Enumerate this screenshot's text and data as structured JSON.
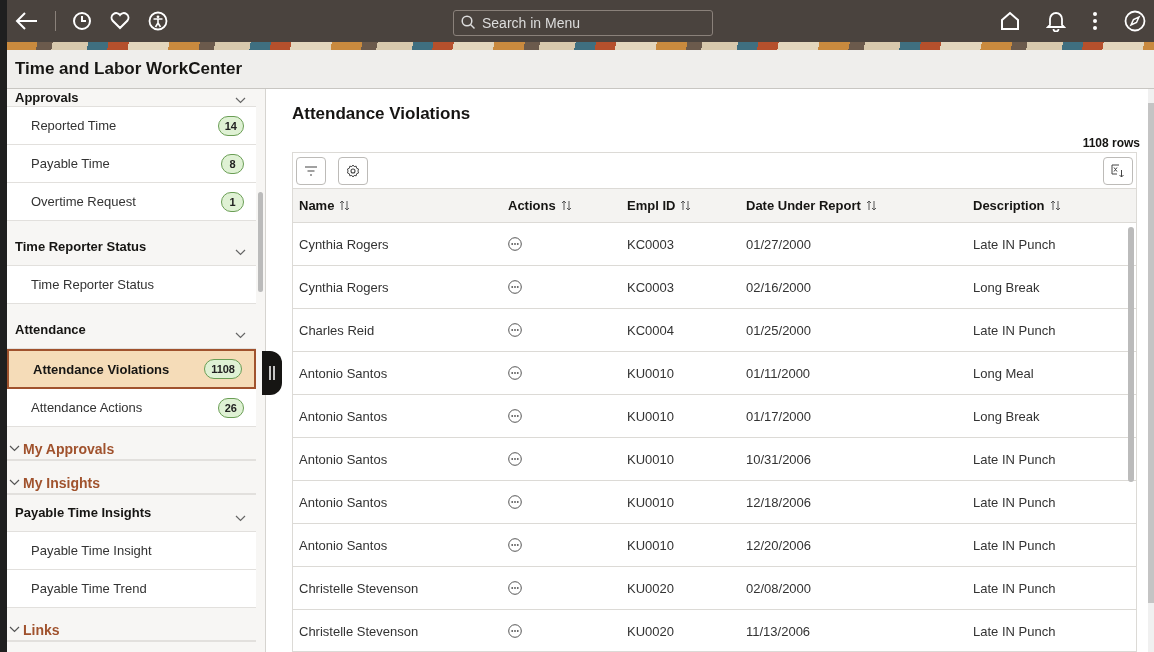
{
  "header": {
    "search": {
      "placeholder": "Search in Menu"
    }
  },
  "page_title": "Time and Labor WorkCenter",
  "sidebar": {
    "items": [
      {
        "kind": "group",
        "label": "Approvals"
      },
      {
        "kind": "link",
        "label": "Reported Time",
        "badge": "14",
        "selected": false
      },
      {
        "kind": "link",
        "label": "Payable Time",
        "badge": "8",
        "selected": false
      },
      {
        "kind": "link",
        "label": "Overtime Request",
        "badge": "1",
        "selected": false
      },
      {
        "kind": "group",
        "label": "Time Reporter Status"
      },
      {
        "kind": "link",
        "label": "Time Reporter Status",
        "selected": false
      },
      {
        "kind": "group",
        "label": "Attendance"
      },
      {
        "kind": "link",
        "label": "Attendance Violations",
        "badge": "1108",
        "selected": true
      },
      {
        "kind": "link",
        "label": "Attendance Actions",
        "badge": "26",
        "selected": false
      },
      {
        "kind": "category",
        "label": "My Approvals"
      },
      {
        "kind": "category",
        "label": "My Insights"
      },
      {
        "kind": "group",
        "label": "Payable Time Insights"
      },
      {
        "kind": "link",
        "label": "Payable Time Insight",
        "selected": false
      },
      {
        "kind": "link",
        "label": "Payable Time Trend",
        "selected": false
      },
      {
        "kind": "category",
        "label": "Links"
      }
    ]
  },
  "content": {
    "title": "Attendance Violations",
    "row_count": "1108 rows",
    "table": {
      "columns": [
        "Name",
        "Actions",
        "Empl ID",
        "Date Under Report",
        "Description"
      ],
      "rows": [
        [
          "Cynthia Rogers",
          "",
          "KC0003",
          "01/27/2000",
          "Late IN Punch"
        ],
        [
          "Cynthia Rogers",
          "",
          "KC0003",
          "02/16/2000",
          "Long Break"
        ],
        [
          "Charles Reid",
          "",
          "KC0004",
          "01/25/2000",
          "Late IN Punch"
        ],
        [
          "Antonio Santos",
          "",
          "KU0010",
          "01/11/2000",
          "Long Meal"
        ],
        [
          "Antonio Santos",
          "",
          "KU0010",
          "01/17/2000",
          "Long Break"
        ],
        [
          "Antonio Santos",
          "",
          "KU0010",
          "10/31/2006",
          "Late IN Punch"
        ],
        [
          "Antonio Santos",
          "",
          "KU0010",
          "12/18/2006",
          "Late IN Punch"
        ],
        [
          "Antonio Santos",
          "",
          "KU0010",
          "12/20/2006",
          "Late IN Punch"
        ],
        [
          "Christelle Stevenson",
          "",
          "KU0020",
          "02/08/2000",
          "Late IN Punch"
        ],
        [
          "Christelle Stevenson",
          "",
          "KU0020",
          "11/13/2006",
          "Late IN Punch"
        ]
      ]
    }
  }
}
